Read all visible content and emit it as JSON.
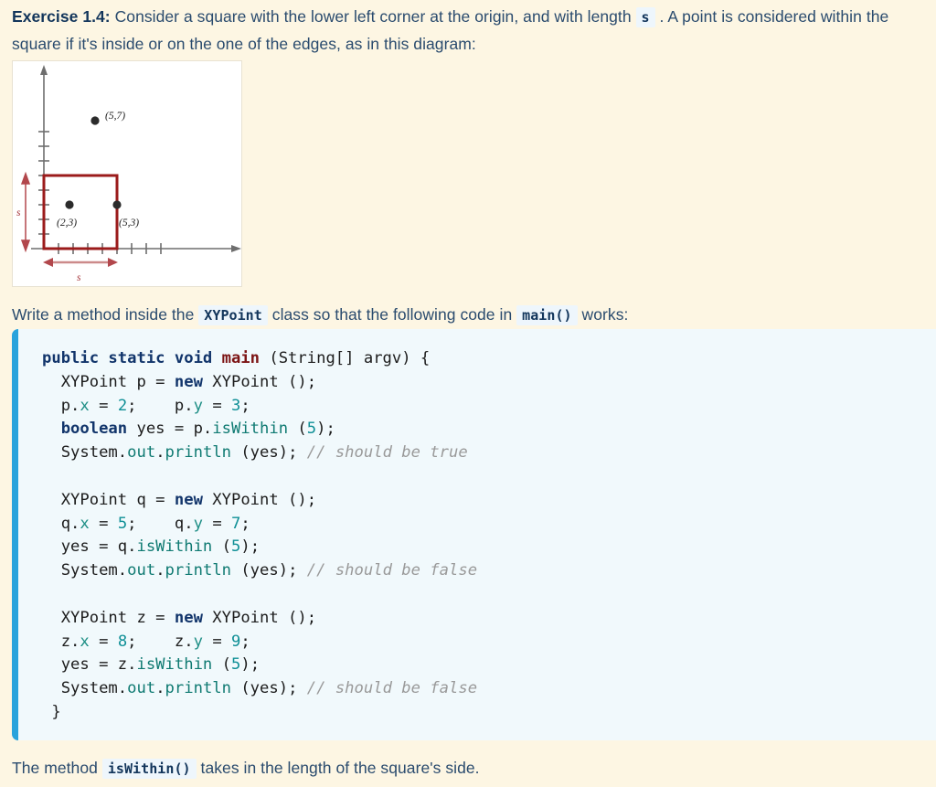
{
  "page": {
    "background_color": "#fdf6e3",
    "text_color": "#2a4b6e"
  },
  "intro": {
    "label": "Exercise 1.4:",
    "text_part1": " Consider a square with the lower left corner at the origin, and with length ",
    "inline_code_s": "s",
    "text_part2": " . A point is considered within the square if it's inside or on the one of the edges, as in this diagram:"
  },
  "diagram": {
    "background_color": "#ffffff",
    "axis_color": "#6e6e6e",
    "square_color": "#9b1b1b",
    "arrow_color": "#c45c5c",
    "point_color": "#2b2b2b",
    "labels": {
      "point_outside": "(5,7)",
      "point_inside": "(2,3)",
      "point_on_edge": "(5,3)",
      "side_vertical": "s",
      "side_horizontal": "s"
    },
    "points": [
      {
        "name": "outside",
        "label": "(5,7)",
        "x": 5,
        "y": 7
      },
      {
        "name": "inside",
        "label": "(2,3)",
        "x": 2,
        "y": 3
      },
      {
        "name": "on-edge",
        "label": "(5,3)",
        "x": 5,
        "y": 3
      }
    ],
    "square": {
      "origin_x": 0,
      "origin_y": 0,
      "side": 5
    },
    "x_axis_ticks": 8,
    "y_axis_ticks": 8
  },
  "line_write": {
    "text_part1": "Write a method inside the ",
    "code_class": "XYPoint",
    "text_part2": " class so that the following code in ",
    "code_main": "main()",
    "text_part3": " works:"
  },
  "code": {
    "accent_color": "#29a3dc",
    "background_color": "#f1f9fc",
    "lines": [
      "public static void main (String[] argv) {",
      "  XYPoint p = new XYPoint ();",
      "  p.x = 2;    p.y = 3;",
      "  boolean yes = p.isWithin (5);",
      "  System.out.println (yes); // should be true",
      "",
      "  XYPoint q = new XYPoint ();",
      "  q.x = 5;    q.y = 7;",
      "  yes = q.isWithin (5);",
      "  System.out.println (yes); // should be false",
      "",
      "  XYPoint z = new XYPoint ();",
      "  z.x = 8;    z.y = 9;",
      "  yes = z.isWithin (5);",
      "  System.out.println (yes); // should be false",
      " }"
    ],
    "comments": [
      "// should be true",
      "// should be false",
      "// should be false"
    ]
  },
  "line_after": {
    "text_part1": "The method ",
    "code_method": "isWithin()",
    "text_part2": " takes in the length of the square's side."
  }
}
